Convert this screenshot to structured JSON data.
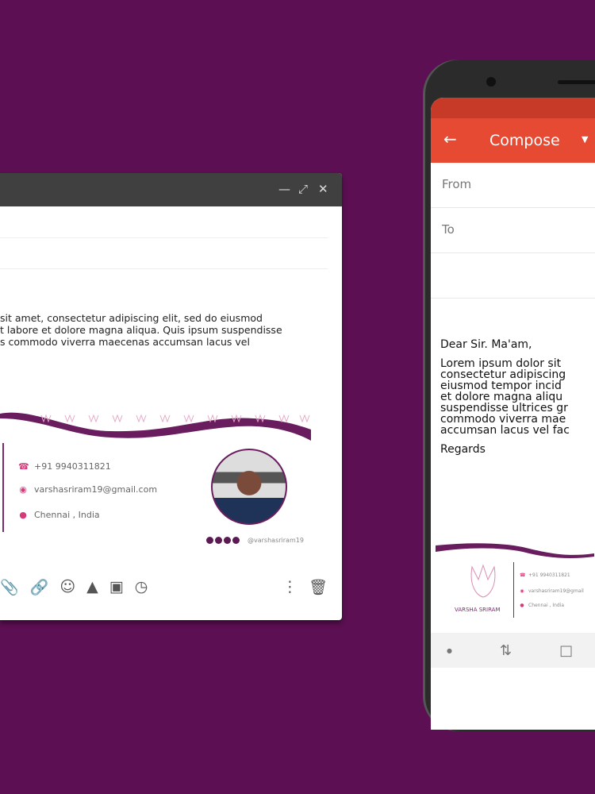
{
  "colors": {
    "background": "#5c0f52",
    "accent": "#e64a33",
    "signature": "#6a1d5e"
  },
  "desktop": {
    "window_controls": [
      "minimize-icon",
      "expand-icon",
      "close-icon"
    ],
    "body_lines": [
      "sit amet, consectetur adipiscing elit, sed do eiusmod",
      "t labore et dolore magna aliqua. Quis ipsum suspendisse",
      "s commodo viverra maecenas accumsan lacus vel"
    ],
    "signature": {
      "phone": "+91 9940311821",
      "email": "varshasriram19@gmail.com",
      "location": "Chennai , India",
      "handle": "@varshasriram19"
    },
    "toolbar": [
      "attach-icon",
      "link-icon",
      "emoji-icon",
      "drive-icon",
      "image-icon",
      "schedule-icon",
      "more-icon",
      "trash-icon"
    ]
  },
  "phone": {
    "title": "Compose",
    "from_label": "From",
    "to_label": "To",
    "greeting": "Dear Sir. Ma'am,",
    "body_lines": [
      "Lorem ipsum dolor sit",
      "consectetur adipiscing",
      "eiusmod tempor incid",
      "et dolore magna aliqu",
      "suspendisse ultrices gr",
      "commodo viverra mae",
      "accumsan lacus vel fac"
    ],
    "closing": "Regards",
    "signature": {
      "logo_name": "VARSHA SRIRAM",
      "phone": "+91 9940311821",
      "email": "varshasriram19@gmail",
      "location": "Chennai , India"
    }
  }
}
